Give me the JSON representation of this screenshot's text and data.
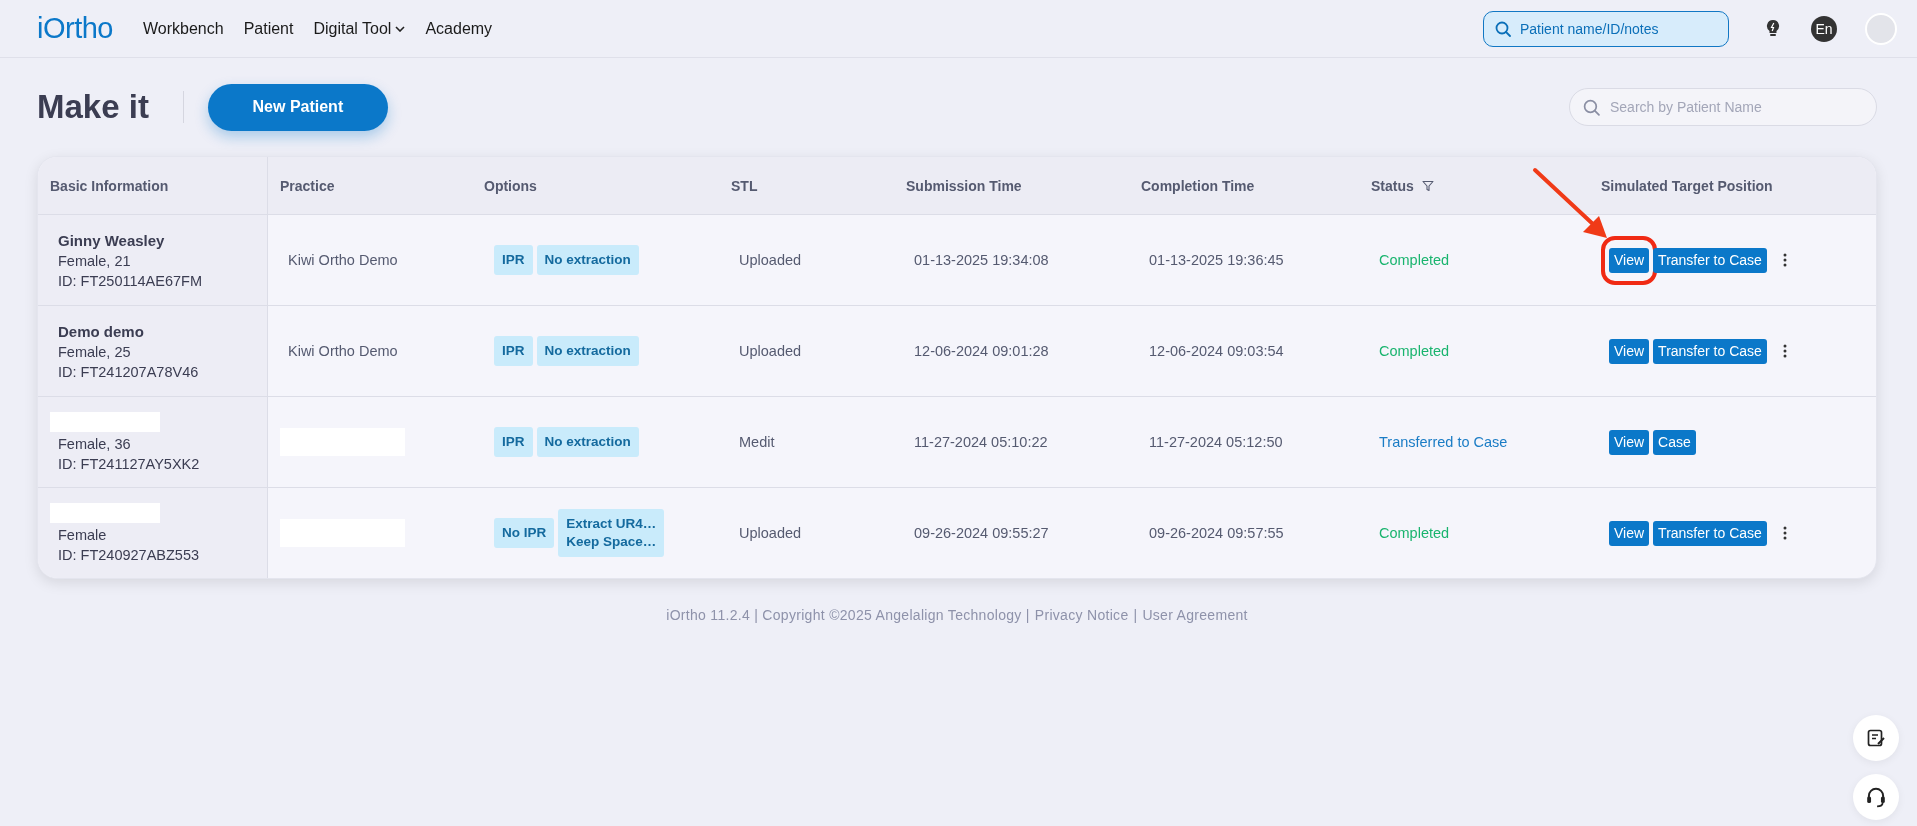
{
  "header": {
    "logo": "iOrtho",
    "nav": [
      {
        "label": "Workbench",
        "dropdown": false
      },
      {
        "label": "Patient",
        "dropdown": false
      },
      {
        "label": "Digital Tool",
        "dropdown": true
      },
      {
        "label": "Academy",
        "dropdown": false
      }
    ],
    "search": {
      "placeholder": "Patient name/ID/notes"
    },
    "language": "En"
  },
  "page": {
    "title": "Make it",
    "new_button": "New Patient",
    "search": {
      "placeholder": "Search by Patient Name"
    }
  },
  "table": {
    "columns": [
      {
        "label": "Basic Information",
        "filter": false
      },
      {
        "label": "Practice",
        "filter": false
      },
      {
        "label": "Options",
        "filter": false
      },
      {
        "label": "STL",
        "filter": false
      },
      {
        "label": "Submission Time",
        "filter": false
      },
      {
        "label": "Completion Time",
        "filter": false
      },
      {
        "label": "Status",
        "filter": true
      },
      {
        "label": "Simulated Target Position",
        "filter": false
      }
    ],
    "rows": [
      {
        "name": "Ginny Weasley",
        "name_redacted": false,
        "sex_age": "Female, 21",
        "id": "ID: FT250114AE67FM",
        "practice": "Kiwi Ortho Demo",
        "practice_redacted": false,
        "options": [
          {
            "lines": [
              "IPR"
            ]
          },
          {
            "lines": [
              "No extraction"
            ]
          }
        ],
        "stl": "Uploaded",
        "submitted": "01-13-2025 19:34:08",
        "completed": "01-13-2025 19:36:45",
        "status": "Completed",
        "status_transferred": false,
        "actions": [
          {
            "label": "View",
            "highlighted": true
          },
          {
            "label": "Transfer to Case",
            "highlighted": false
          }
        ],
        "more_menu": true
      },
      {
        "name": "Demo demo",
        "name_redacted": false,
        "sex_age": "Female, 25",
        "id": "ID: FT241207A78V46",
        "practice": "Kiwi Ortho Demo",
        "practice_redacted": false,
        "options": [
          {
            "lines": [
              "IPR"
            ]
          },
          {
            "lines": [
              "No extraction"
            ]
          }
        ],
        "stl": "Uploaded",
        "submitted": "12-06-2024 09:01:28",
        "completed": "12-06-2024 09:03:54",
        "status": "Completed",
        "status_transferred": false,
        "actions": [
          {
            "label": "View",
            "highlighted": false
          },
          {
            "label": "Transfer to Case",
            "highlighted": false
          }
        ],
        "more_menu": true
      },
      {
        "name_redacted": true,
        "sex_age": "Female, 36",
        "id": "ID: FT241127AY5XK2",
        "practice_redacted": true,
        "options": [
          {
            "lines": [
              "IPR"
            ]
          },
          {
            "lines": [
              "No extraction"
            ]
          }
        ],
        "stl": "Medit",
        "submitted": "11-27-2024 05:10:22",
        "completed": "11-27-2024 05:12:50",
        "status": "Transferred to Case",
        "status_transferred": true,
        "actions": [
          {
            "label": "View",
            "highlighted": false
          },
          {
            "label": "Case",
            "highlighted": false
          }
        ],
        "more_menu": false
      },
      {
        "name_redacted": true,
        "sex_age": "Female",
        "id": "ID: FT240927ABZ553",
        "practice_redacted": true,
        "options": [
          {
            "lines": [
              "No IPR"
            ]
          },
          {
            "lines": [
              "Extract UR4…",
              "Keep Space…"
            ]
          }
        ],
        "stl": "Uploaded",
        "submitted": "09-26-2024 09:55:27",
        "completed": "09-26-2024 09:57:55",
        "status": "Completed",
        "status_transferred": false,
        "actions": [
          {
            "label": "View",
            "highlighted": false
          },
          {
            "label": "Transfer to Case",
            "highlighted": false
          }
        ],
        "more_menu": true
      }
    ]
  },
  "footer": {
    "text": "iOrtho 11.2.4 | Copyright ©2025 Angelalign Technology |",
    "links": [
      "Privacy Notice",
      "User Agreement"
    ],
    "separator": "|"
  }
}
